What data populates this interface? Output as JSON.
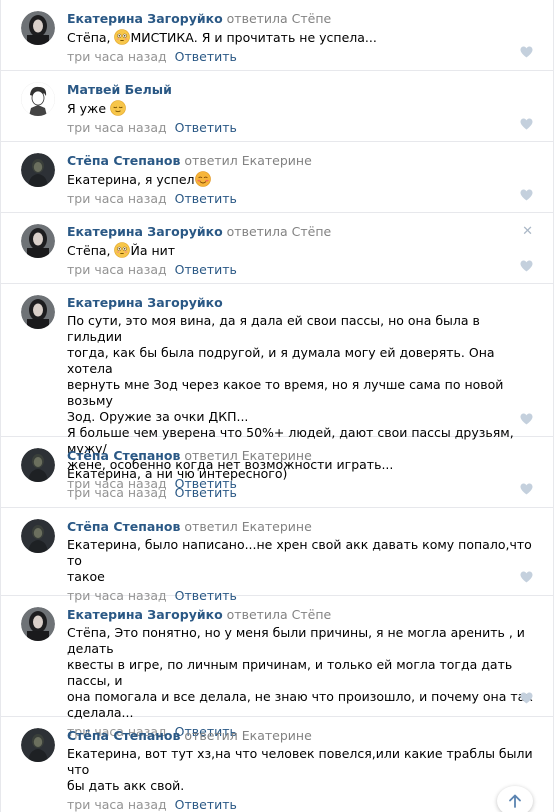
{
  "comments": [
    {
      "author": "Екатерина Загоруйко",
      "reply_to": "ответила Стёпе",
      "text_parts": [
        "Стёпа, ",
        "МИСТИКА. Я и прочитать не успела..."
      ],
      "time": "три часа назад",
      "reply_label": "Ответить",
      "avatar": "woman-dark-hair"
    },
    {
      "author": "Матвей Белый",
      "reply_to": "",
      "text_parts": [
        "Я уже ",
        ""
      ],
      "time": "три часа назад",
      "reply_label": "Ответить",
      "avatar": "sketch-boy"
    },
    {
      "author": "Стёпа Степанов",
      "reply_to": "ответил Екатерине",
      "text_parts": [
        "Екатерина, я успел",
        ""
      ],
      "time": "три часа назад",
      "reply_label": "Ответить",
      "avatar": "man-dark"
    },
    {
      "author": "Екатерина Загоруйко",
      "reply_to": "ответила Стёпе",
      "text_parts": [
        "Стёпа, ",
        "Йа нит"
      ],
      "time": "три часа назад",
      "reply_label": "Ответить",
      "avatar": "woman-dark-hair"
    },
    {
      "author": "Екатерина Загоруйко",
      "reply_to": "",
      "lines": [
        "По сути, это моя вина, да я дала ей свои пассы, но она была в гильдии",
        "тогда, как бы была подругой, и я думала могу ей доверять. Она хотела",
        "вернуть мне Зод через какое то время, но я лучше сама по новой возьму",
        "Зод. Оружие за очки ДКП...",
        "Я больше чем уверена что 50%+ людей, дают свои пассы друзьям, мужу/",
        "жене, особенно когда нет возможности играть..."
      ],
      "time": "три часа назад",
      "reply_label": "Ответить",
      "avatar": "woman-dark-hair"
    },
    {
      "author": "Стёпа Степанов",
      "reply_to": "ответил Екатерине",
      "lines": [
        "Екатерина, а ни чю интересного)"
      ],
      "time": "три часа назад",
      "reply_label": "Ответить",
      "avatar": "man-dark"
    },
    {
      "author": "Стёпа Степанов",
      "reply_to": "ответил Екатерине",
      "lines": [
        "Екатерина, было написано...не хрен свой акк давать кому попало,что то",
        "такое"
      ],
      "time": "три часа назад",
      "reply_label": "Ответить",
      "avatar": "man-dark"
    },
    {
      "author": "Екатерина Загоруйко",
      "reply_to": "ответила Стёпе",
      "lines": [
        "Стёпа, Это понятно, но у меня были причины, я не могла аренить , и делать",
        "квесты в игре, по личным причинам, и только ей могла тогда дать пассы, и",
        "она помогала и все делала, не знаю что произошло, и почему она так",
        "сделала..."
      ],
      "time": "три часа назад",
      "reply_label": "Ответить",
      "avatar": "woman-dark-hair"
    },
    {
      "author": "Стёпа Степанов",
      "reply_to": "ответил Екатерине",
      "lines": [
        "Екатерина, вот тут хз,на что человек повелся,или какие траблы были что",
        "бы дать акк свой."
      ],
      "time": "три часа назад",
      "reply_label": "Ответить",
      "avatar": "man-dark"
    }
  ],
  "colors": {
    "link": "#2a5885",
    "meta": "#939393",
    "divider": "#e7e8ec",
    "like": "#c4d0dd"
  },
  "icons": {
    "like": "heart-icon",
    "close": "close-icon",
    "scroll": "arrow-up-icon"
  }
}
